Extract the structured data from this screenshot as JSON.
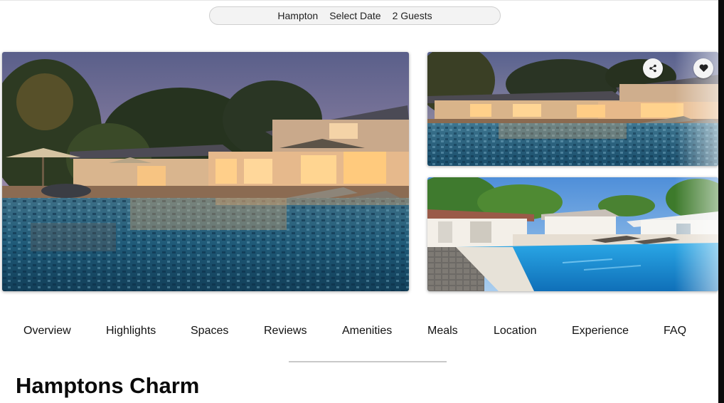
{
  "search": {
    "location": "Hampton",
    "date": "Select Date",
    "guests": "2 Guests"
  },
  "gallery": {
    "main_photo": "villa-pool-dusk",
    "top_photo": "villa-pool-evening",
    "bottom_photo": "villa-pool-daytime",
    "share_icon": "share-icon",
    "favorite_icon": "heart-icon"
  },
  "tabs": [
    {
      "label": "Overview"
    },
    {
      "label": "Highlights"
    },
    {
      "label": "Spaces"
    },
    {
      "label": "Reviews"
    },
    {
      "label": "Amenities"
    },
    {
      "label": "Meals"
    },
    {
      "label": "Location"
    },
    {
      "label": "Experience"
    },
    {
      "label": "FAQ"
    }
  ],
  "property": {
    "title": "Hamptons Charm"
  }
}
